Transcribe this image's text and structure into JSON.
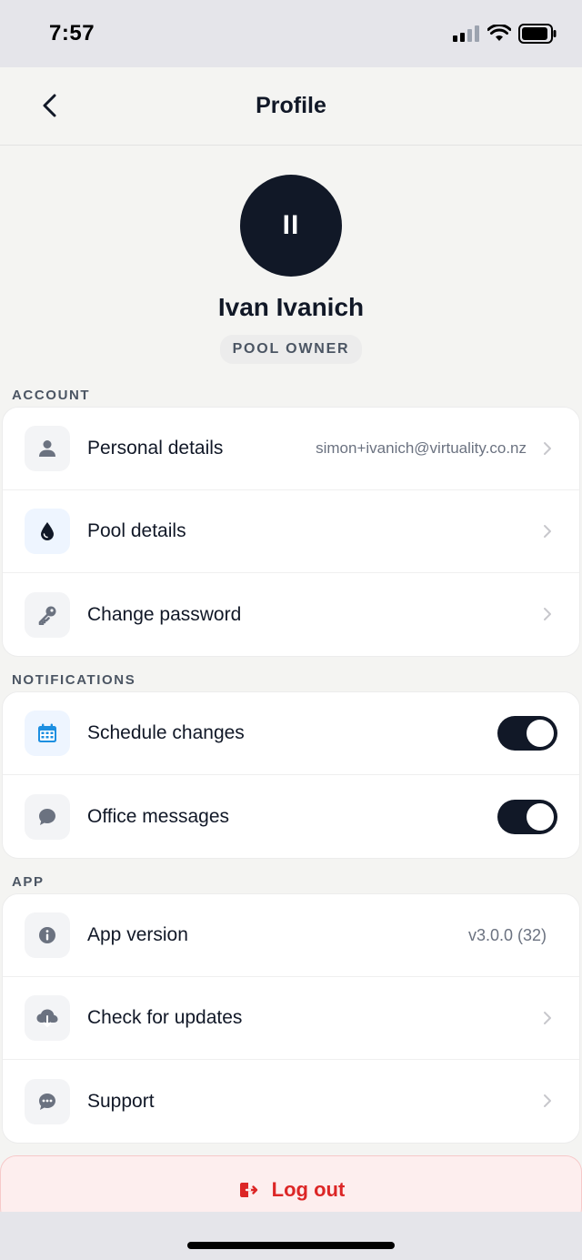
{
  "status_bar": {
    "time": "7:57"
  },
  "nav": {
    "title": "Profile"
  },
  "profile": {
    "initials": "II",
    "name": "Ivan Ivanich",
    "role": "POOL OWNER"
  },
  "sections": {
    "account": {
      "label": "ACCOUNT",
      "items": [
        {
          "label": "Personal details",
          "value": "simon+ivanich@virtuality.co.nz",
          "icon": "person-icon"
        },
        {
          "label": "Pool details",
          "icon": "water-drop-icon"
        },
        {
          "label": "Change password",
          "icon": "key-icon"
        }
      ]
    },
    "notifications": {
      "label": "NOTIFICATIONS",
      "items": [
        {
          "label": "Schedule changes",
          "icon": "calendar-icon",
          "enabled": true
        },
        {
          "label": "Office messages",
          "icon": "chat-bubble-icon",
          "enabled": true
        }
      ]
    },
    "app": {
      "label": "APP",
      "items": [
        {
          "label": "App version",
          "value": "v3.0.0 (32)",
          "icon": "info-icon"
        },
        {
          "label": "Check for updates",
          "icon": "cloud-download-icon"
        },
        {
          "label": "Support",
          "icon": "support-chat-icon"
        }
      ]
    }
  },
  "logout": {
    "label": "Log out"
  },
  "colors": {
    "primary": "#111827",
    "danger": "#dc2626",
    "accent_blue": "#1d8fe1",
    "background": "#f4f4f2"
  }
}
